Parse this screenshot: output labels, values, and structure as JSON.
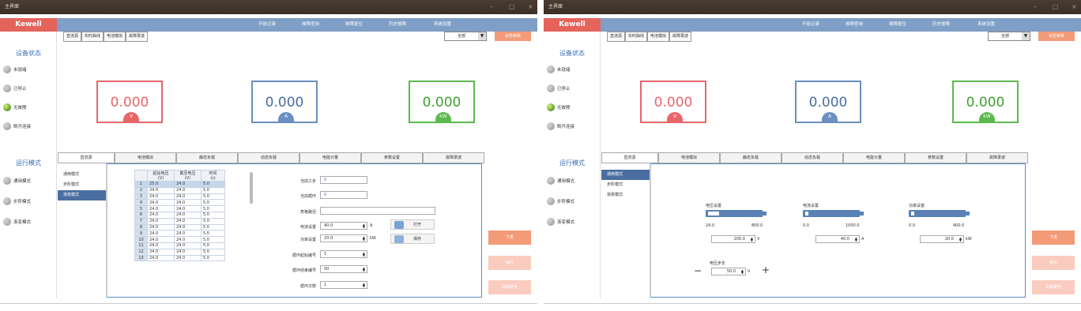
{
  "windows": [
    {
      "title": "主界面",
      "brand": "Kewell",
      "nav": [
        "开始记录",
        "故障查询",
        "故障复位",
        "历史故障",
        "系统设置"
      ],
      "tabs": [
        "直流源",
        "实时曲线",
        "电池模拟",
        "故障录波"
      ],
      "select": "全部",
      "top_right_button": "状态参数",
      "device_status_title": "设备状态",
      "statuses": [
        {
          "label": "未就绪",
          "on": false
        },
        {
          "label": "已停止",
          "on": false
        },
        {
          "label": "无故障",
          "on": true
        },
        {
          "label": "断开连接",
          "on": false
        }
      ],
      "run_mode_title": "运行模式",
      "run_modes": [
        {
          "label": "通用模式"
        },
        {
          "label": "步阶模式"
        },
        {
          "label": "渐变模式"
        }
      ],
      "gauges": [
        {
          "value": "0.000",
          "unit": "V",
          "color": "#e8666a"
        },
        {
          "value": "0.000",
          "unit": "A",
          "color": "#6a8fc0"
        },
        {
          "value": "0.000",
          "unit": "kW",
          "color": "#5cb94d"
        }
      ],
      "bottom_tabs": [
        "直流源",
        "电池模拟",
        "静态负载",
        "动态负载",
        "电能计量",
        "参数设置",
        "故障录波"
      ],
      "mode_list": [
        "通用模式",
        "步阶模式",
        "渐变模式"
      ],
      "active_mode": 2,
      "right_buttons": [
        "下发",
        "运行",
        "清除警告"
      ],
      "table": {
        "headers": [
          "",
          "起始电压\n(V)",
          "截至电压\n(V)",
          "时间\n(s)"
        ],
        "rows": [
          [
            "1",
            "25.0",
            "24.0",
            "5.0"
          ],
          [
            "2",
            "24.0",
            "24.0",
            "5.0"
          ],
          [
            "3",
            "24.0",
            "24.0",
            "5.0"
          ],
          [
            "4",
            "24.0",
            "24.0",
            "5.0"
          ],
          [
            "5",
            "24.0",
            "24.0",
            "5.0"
          ],
          [
            "6",
            "24.0",
            "24.0",
            "5.0"
          ],
          [
            "7",
            "24.0",
            "24.0",
            "5.0"
          ],
          [
            "8",
            "24.0",
            "24.0",
            "5.0"
          ],
          [
            "9",
            "24.0",
            "24.0",
            "5.0"
          ],
          [
            "10",
            "24.0",
            "24.0",
            "5.0"
          ],
          [
            "11",
            "24.0",
            "24.0",
            "5.0"
          ],
          [
            "12",
            "24.0",
            "24.0",
            "5.0"
          ],
          [
            "13",
            "24.0",
            "24.0",
            "5.0"
          ]
        ]
      },
      "fields": {
        "current_step": {
          "label": "当前工步",
          "value": "0"
        },
        "current_loop": {
          "label": "当前循环",
          "value": "0"
        },
        "table_path": {
          "label": "表格路径",
          "value": ""
        },
        "current_set": {
          "label": "电流设置",
          "value": "40.0",
          "unit": "A"
        },
        "power_set": {
          "label": "功率设置",
          "value": "20.0",
          "unit": "kW"
        },
        "loop_start": {
          "label": "循环起始编号",
          "value": "1"
        },
        "loop_end": {
          "label": "循环结束编号",
          "value": "50"
        },
        "loop_count": {
          "label": "循环次数",
          "value": "1"
        }
      },
      "open_button": "打开",
      "save_button": "保存"
    },
    {
      "title": "主界面",
      "brand": "Kewell",
      "nav": [
        "开始记录",
        "故障查询",
        "故障复位",
        "历史故障",
        "系统设置"
      ],
      "tabs": [
        "直流源",
        "实时曲线",
        "电池模拟",
        "故障录波"
      ],
      "select": "全部",
      "top_right_button": "状态参数",
      "device_status_title": "设备状态",
      "statuses": [
        {
          "label": "未就绪",
          "on": false
        },
        {
          "label": "已停止",
          "on": false
        },
        {
          "label": "无故障",
          "on": true
        },
        {
          "label": "断开连接",
          "on": false
        }
      ],
      "run_mode_title": "运行模式",
      "run_modes": [
        {
          "label": "通用模式"
        },
        {
          "label": "步阶模式"
        },
        {
          "label": "渐变模式"
        }
      ],
      "gauges": [
        {
          "value": "0.000",
          "unit": "V",
          "color": "#e8666a"
        },
        {
          "value": "0.000",
          "unit": "A",
          "color": "#6a8fc0"
        },
        {
          "value": "0.000",
          "unit": "kW",
          "color": "#5cb94d"
        }
      ],
      "bottom_tabs": [
        "直流源",
        "电池模拟",
        "静态负载",
        "动态负载",
        "电能计量",
        "参数设置",
        "故障录波"
      ],
      "mode_list": [
        "通用模式",
        "步阶模式",
        "渐变模式"
      ],
      "active_mode": 0,
      "right_buttons": [
        "下发",
        "运行",
        "清除警告"
      ],
      "sliders": [
        {
          "label": "电压设置",
          "min": "24.0",
          "max": "800.0",
          "value": "200.0",
          "unit": "V",
          "level": 0.23
        },
        {
          "label": "电流设置",
          "min": "0.0",
          "max": "1000.0",
          "value": "40.0",
          "unit": "A",
          "level": 0.04
        },
        {
          "label": "功率设置",
          "min": "0.0",
          "max": "400.0",
          "value": "20.0",
          "unit": "kW",
          "level": 0.05
        }
      ],
      "step": {
        "label": "电压步长",
        "value": "50.0",
        "unit": "V",
        "minus": "−",
        "plus": "+"
      }
    }
  ]
}
